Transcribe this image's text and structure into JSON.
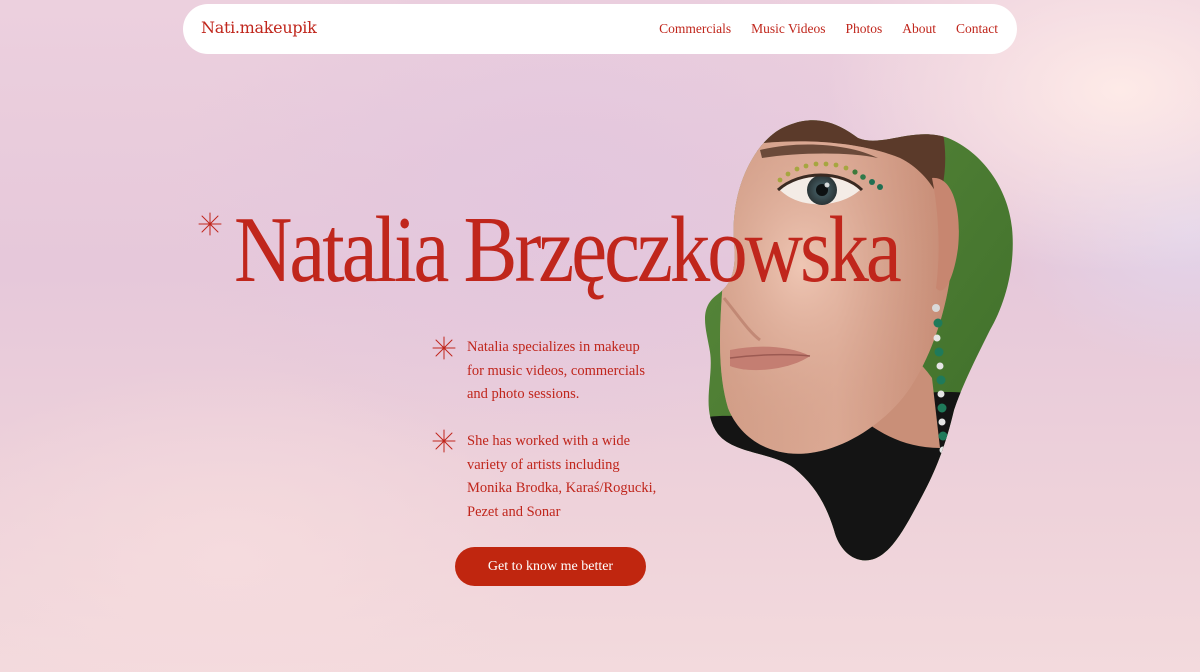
{
  "header": {
    "brand": "Nati.makeupik",
    "nav": [
      {
        "label": "Commercials"
      },
      {
        "label": "Music Videos"
      },
      {
        "label": "Photos"
      },
      {
        "label": "About"
      },
      {
        "label": "Contact"
      }
    ]
  },
  "hero": {
    "title": "Natalia Brzęczkowska",
    "paragraphs": [
      {
        "lines": [
          "Natalia specializes in makeup",
          "for music videos, commercials",
          "and photo sessions."
        ]
      },
      {
        "lines": [
          "She has worked with a wide",
          "variety of artists including",
          "Monika Brodka, Karaś/Rogucki,",
          "Pezet and Sonar"
        ]
      }
    ],
    "cta_label": "Get to know me better"
  },
  "icons": {
    "decor": "sparkle-star-icon"
  },
  "colors": {
    "accent": "#c0261c",
    "button": "#c0260f",
    "background": "#e8cadc"
  }
}
